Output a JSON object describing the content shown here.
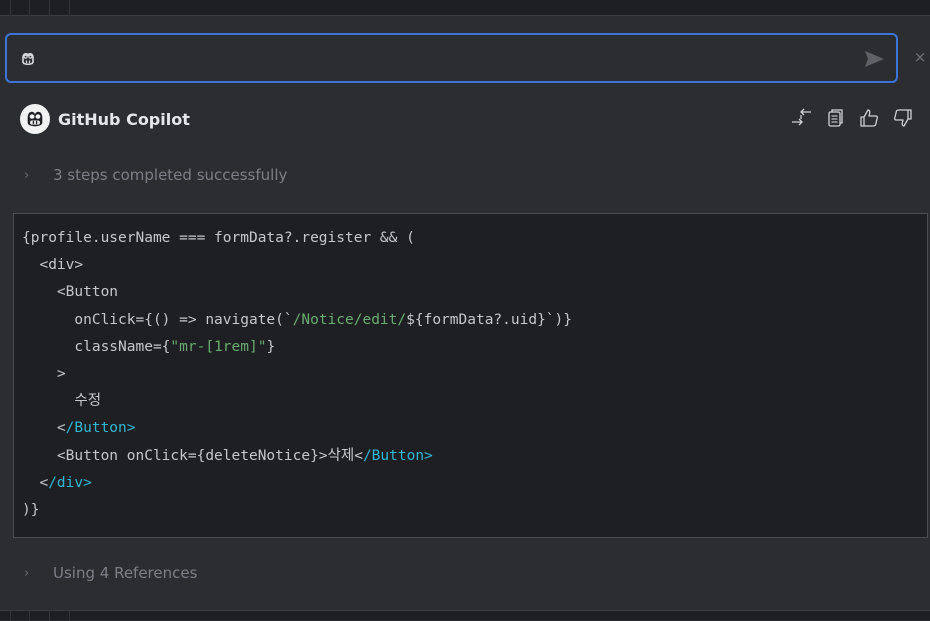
{
  "prompt": {
    "value": "",
    "placeholder": "",
    "icon": "copilot-icon",
    "send_icon": "send-icon",
    "close_label": "×"
  },
  "header": {
    "title": "GitHub Copilot",
    "avatar_icon": "copilot-icon",
    "actions": [
      {
        "name": "insert-at-caret",
        "icon": "arrows-exchange-icon"
      },
      {
        "name": "copy",
        "icon": "copy-icon"
      },
      {
        "name": "thumbs-up",
        "icon": "thumbs-up-icon"
      },
      {
        "name": "thumbs-down",
        "icon": "thumbs-down-icon"
      }
    ]
  },
  "steps": {
    "chevron": "›",
    "label": "3 steps completed successfully"
  },
  "code": {
    "lines": [
      [
        {
          "t": "{profile.userName === formData?.register && (",
          "c": "plain"
        }
      ],
      [
        {
          "t": "  <div>",
          "c": "plain"
        }
      ],
      [
        {
          "t": "    <Button",
          "c": "plain"
        }
      ],
      [
        {
          "t": "      onClick={() => navigate(`",
          "c": "plain"
        },
        {
          "t": "/Notice/edit/",
          "c": "str"
        },
        {
          "t": "${formData?.uid}`)}",
          "c": "plain"
        }
      ],
      [
        {
          "t": "      className={",
          "c": "plain"
        },
        {
          "t": "\"mr-[1rem]\"",
          "c": "str"
        },
        {
          "t": "}",
          "c": "plain"
        }
      ],
      [
        {
          "t": "    >",
          "c": "plain"
        }
      ],
      [
        {
          "t": "      수정",
          "c": "plain"
        }
      ],
      [
        {
          "t": "    <",
          "c": "plain"
        },
        {
          "t": "/Button>",
          "c": "tag"
        }
      ],
      [
        {
          "t": "    <Button onClick={deleteNotice}>삭제<",
          "c": "plain"
        },
        {
          "t": "/Button>",
          "c": "tag"
        }
      ],
      [
        {
          "t": "  <",
          "c": "plain"
        },
        {
          "t": "/div>",
          "c": "tag"
        }
      ],
      [
        {
          "t": ")}",
          "c": "plain"
        }
      ]
    ]
  },
  "references": {
    "chevron": "›",
    "label": "Using 4 References"
  },
  "colors": {
    "accent": "#3d74d9",
    "string": "#6aab73",
    "tag": "#2fb7d4"
  }
}
